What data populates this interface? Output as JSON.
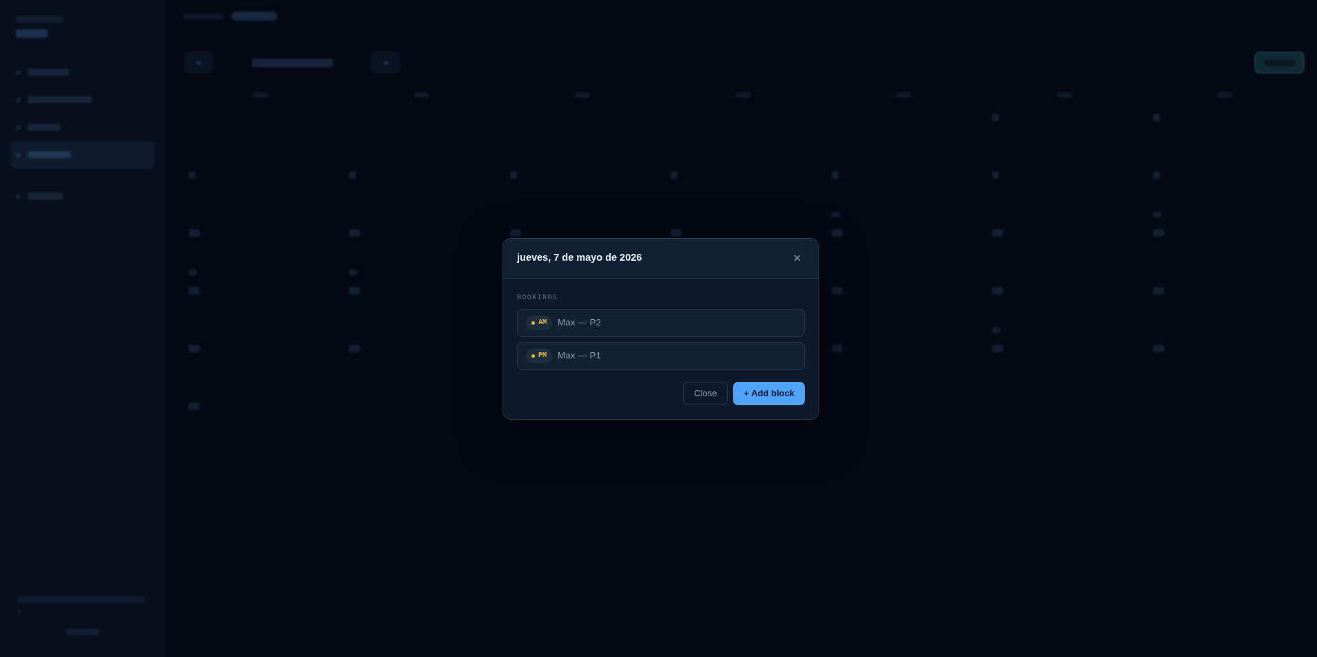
{
  "backdrop": {
    "nav_items": [
      {
        "selected": false
      },
      {
        "selected": false
      },
      {
        "selected": false
      },
      {
        "selected": true
      },
      {
        "selected": false
      }
    ],
    "calendar": {
      "weeks": [
        {
          "days": [
            {
              "kind": "empty"
            },
            {
              "kind": "empty"
            },
            {
              "kind": "empty"
            },
            {
              "kind": "empty"
            },
            {
              "kind": "empty"
            },
            {
              "kind": "day",
              "booked": false
            },
            {
              "kind": "day",
              "booked": false
            }
          ]
        },
        {
          "days": [
            {
              "kind": "day",
              "booked": false
            },
            {
              "kind": "day",
              "booked": false
            },
            {
              "kind": "day",
              "booked": false
            },
            {
              "kind": "day",
              "booked": false
            },
            {
              "kind": "day",
              "booked": true
            },
            {
              "kind": "day",
              "booked": false
            },
            {
              "kind": "day",
              "booked": true
            }
          ]
        },
        {
          "days": [
            {
              "kind": "day",
              "booked": true
            },
            {
              "kind": "day",
              "booked": true
            },
            {
              "kind": "day",
              "booked": false
            },
            {
              "kind": "day",
              "booked": false
            },
            {
              "kind": "day",
              "booked": false
            },
            {
              "kind": "day",
              "booked": false
            },
            {
              "kind": "day",
              "booked": false
            }
          ]
        },
        {
          "days": [
            {
              "kind": "day",
              "booked": false
            },
            {
              "kind": "day",
              "booked": false
            },
            {
              "kind": "covered"
            },
            {
              "kind": "covered"
            },
            {
              "kind": "day",
              "booked": false
            },
            {
              "kind": "day",
              "booked": true
            },
            {
              "kind": "day",
              "booked": false
            }
          ]
        },
        {
          "days": [
            {
              "kind": "day",
              "booked": false
            },
            {
              "kind": "day",
              "booked": false
            },
            {
              "kind": "covered"
            },
            {
              "kind": "covered"
            },
            {
              "kind": "day",
              "booked": false
            },
            {
              "kind": "day",
              "booked": false
            },
            {
              "kind": "day",
              "booked": false
            }
          ]
        },
        {
          "days": [
            {
              "kind": "day",
              "booked": false
            },
            {
              "kind": "empty"
            },
            {
              "kind": "empty"
            },
            {
              "kind": "empty"
            },
            {
              "kind": "empty"
            },
            {
              "kind": "empty"
            },
            {
              "kind": "empty"
            }
          ]
        }
      ]
    }
  },
  "dialog": {
    "title": "jueves, 7 de mayo de 2026",
    "section_label": "BOOKINGS",
    "bookings": [
      {
        "slot": "AM",
        "label": "Max — P2"
      },
      {
        "slot": "PM",
        "label": "Max — P1"
      }
    ],
    "buttons": [
      {
        "label": "Close",
        "kind": "secondary"
      },
      {
        "label": "+ Add block",
        "kind": "primary"
      }
    ]
  }
}
